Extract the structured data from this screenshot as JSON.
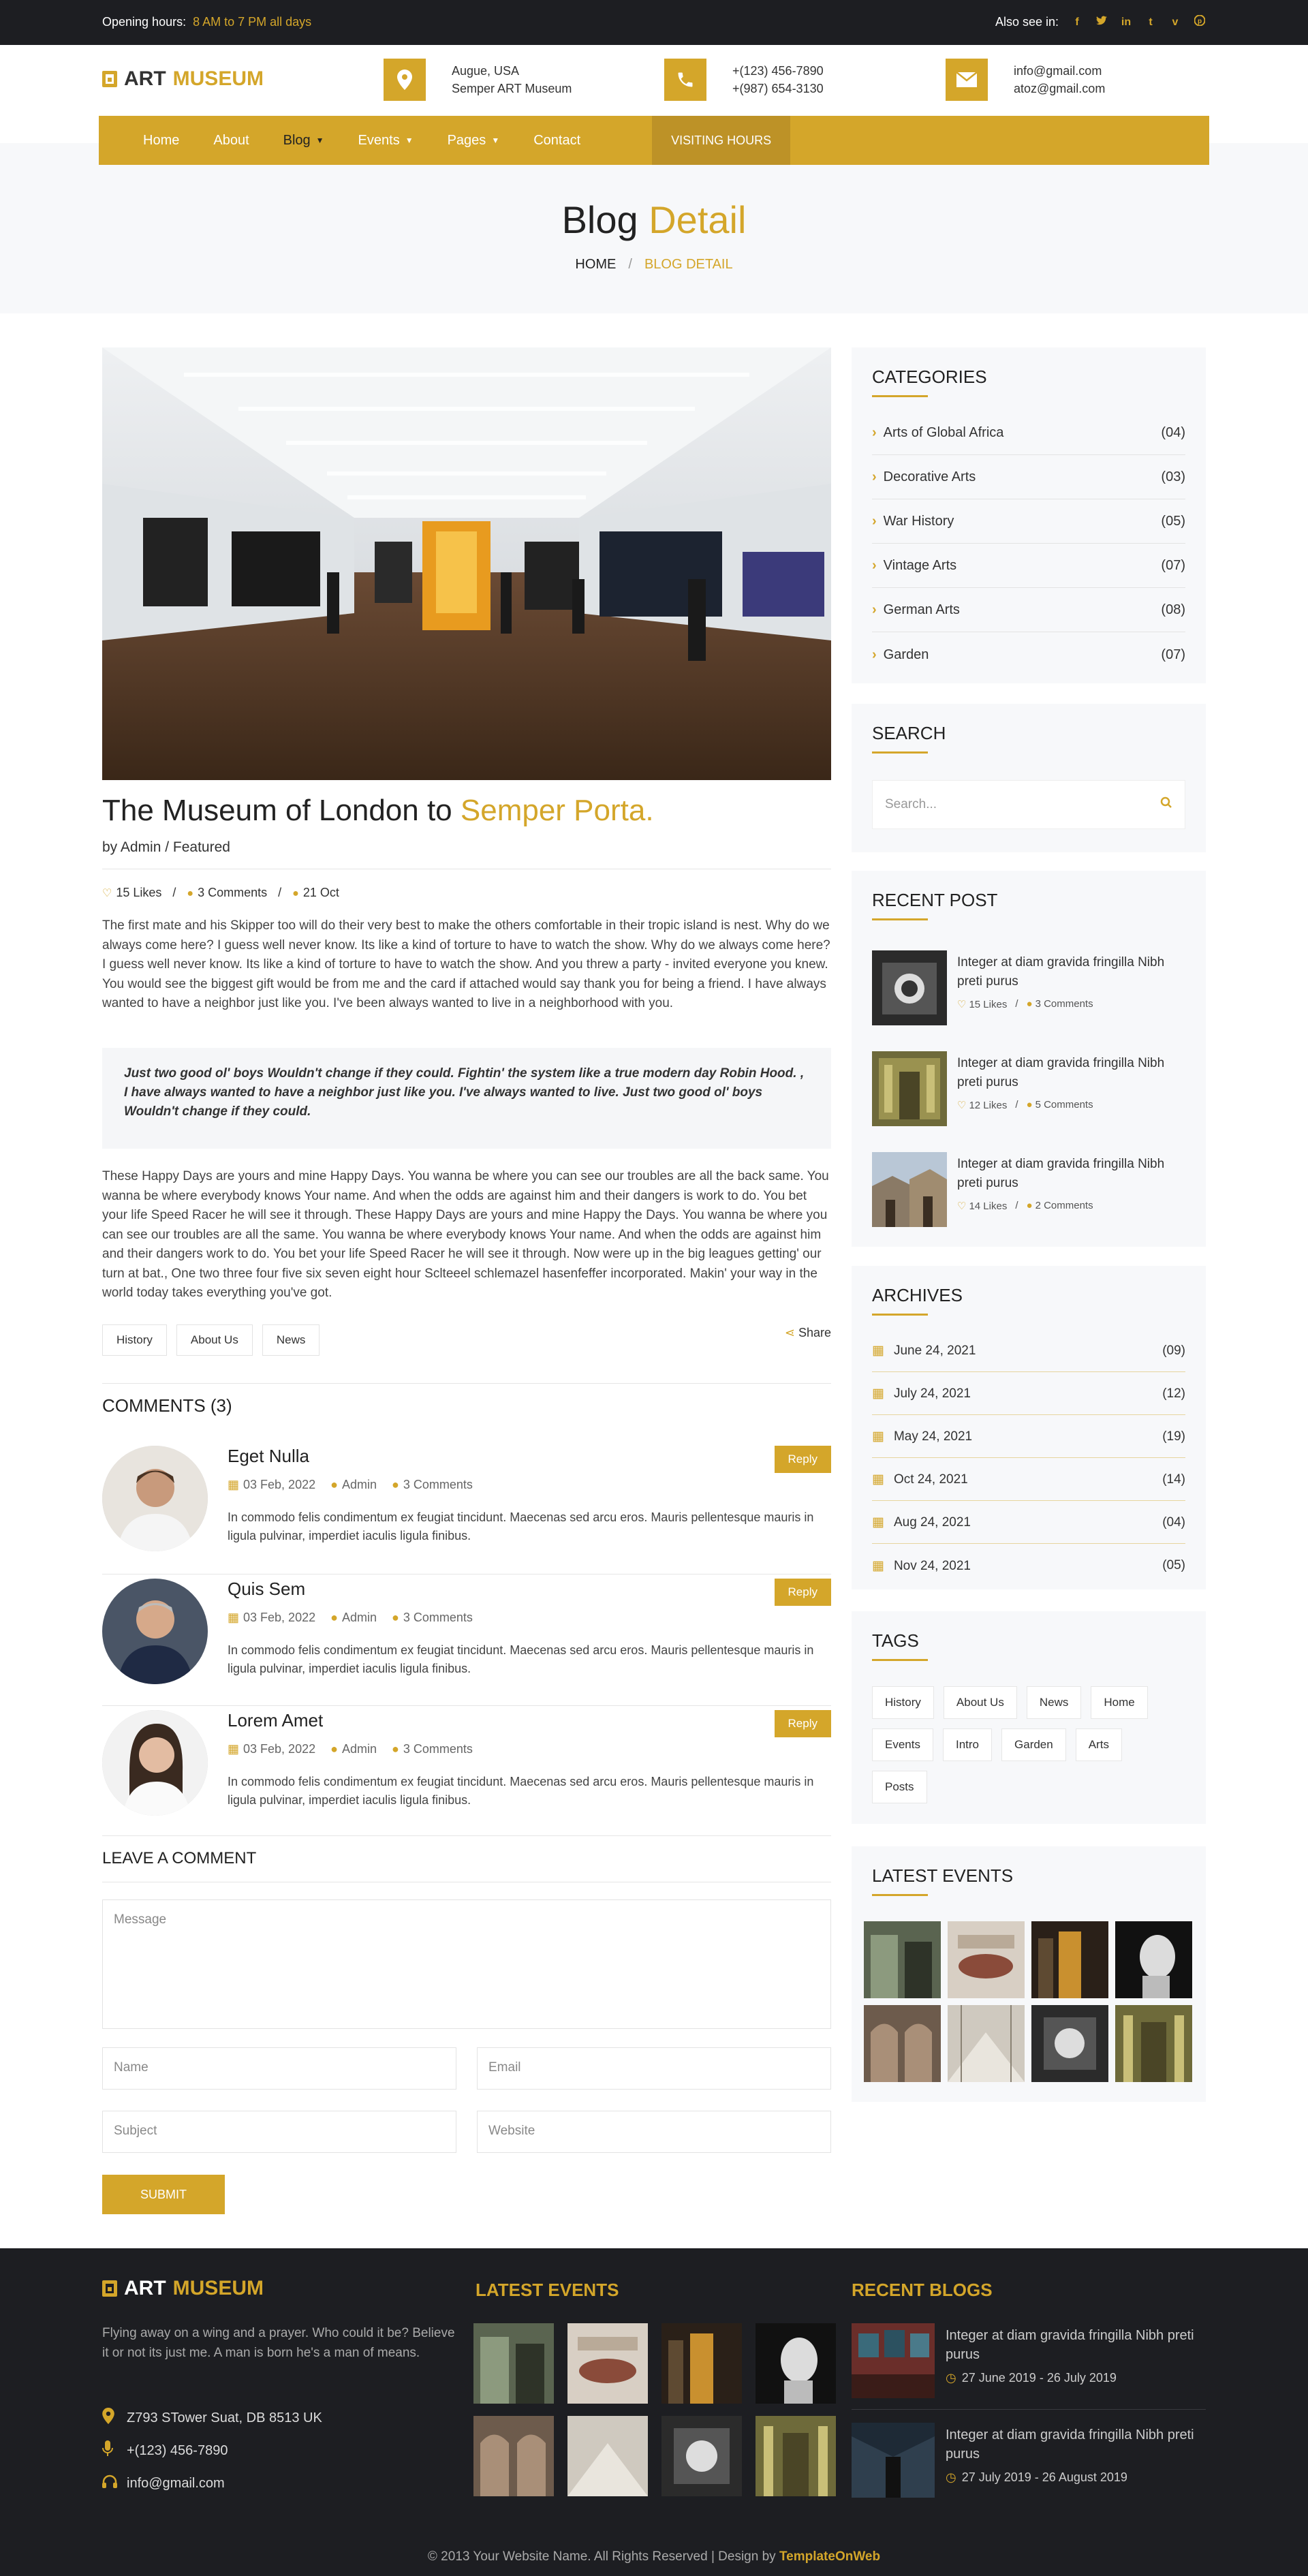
{
  "topbar": {
    "hours_label": "Opening hours:",
    "hours_value": "8 AM to 7 PM all days",
    "see_label": "Also see in:",
    "social": [
      "f",
      "t",
      "in",
      "t",
      "v",
      "p"
    ]
  },
  "brand": {
    "word1": "ART",
    "word2": "MUSEUM"
  },
  "header": {
    "address": [
      "Augue, USA",
      "Semper ART Museum"
    ],
    "phones": [
      "+(123) 456-7890",
      "+(987) 654-3130"
    ],
    "emails": [
      "info@gmail.com",
      "atoz@gmail.com"
    ]
  },
  "nav": {
    "items": [
      "Home",
      "About",
      "Blog",
      "Events",
      "Pages",
      "Contact"
    ],
    "visiting": "VISITING HOURS"
  },
  "page_title": {
    "part1": "Blog",
    "part2": "Detail",
    "crumb_home": "HOME",
    "crumb_sep": "/",
    "crumb_current": "BLOG DETAIL"
  },
  "post": {
    "title1": "The Museum of London to",
    "title2": "Semper Porta.",
    "by": "by Admin / Featured",
    "likes": "15 Likes",
    "comments": "3 Comments",
    "date": "21 Oct",
    "sep": "/",
    "para1": "The first mate and his Skipper too will do their very best to make the others comfortable in their tropic island is nest. Why do we always come here? I guess well never know. Its like a kind of torture to have to watch the show. Why do we always come here? I guess well never know. Its like a kind of torture to have to watch the show. And you threw a party - invited everyone you knew. You would see the biggest gift would be from me and the card if attached would say thank you for being a friend. I have always wanted to have a neighbor just like you. I've been always wanted to live in a neighborhood with you.",
    "quote": "Just two good ol' boys Wouldn't change if they could. Fightin' the system like a true modern day Robin Hood. , I have always wanted to have a neighbor just like you. I've always wanted to live. Just two good ol' boys Wouldn't change if they could.",
    "para2": "These Happy Days are yours and mine Happy Days. You wanna be where you can see our troubles are all the back same. You wanna be where everybody knows Your name. And when the odds are against him and their dangers is work to do. You bet your life Speed Racer he will see it through. These Happy Days are yours and mine Happy the Days. You wanna be where you can see our troubles are all the same. You wanna be where everybody knows Your name. And when the odds are against him and their dangers work to do. You bet your life Speed Racer he will see it through. Now were up in the big leagues getting' our turn at bat., One two three four five six seven eight hour Sclteeel schlemazel hasenfeffer incorporated. Makin' your way in the world today takes everything you've got.",
    "tags": [
      "History",
      "About Us",
      "News"
    ],
    "share": "Share"
  },
  "comments": {
    "heading": "COMMENTS (3)",
    "items": [
      {
        "name": "Eget Nulla",
        "date": "03 Feb, 2022",
        "author": "Admin",
        "count": "3 Comments",
        "body": "In commodo felis condimentum ex feugiat tincidunt. Maecenas sed arcu eros. Mauris pellentesque mauris in ligula pulvinar, imperdiet iaculis ligula finibus.",
        "reply": "Reply"
      },
      {
        "name": "Quis Sem",
        "date": "03 Feb, 2022",
        "author": "Admin",
        "count": "3 Comments",
        "body": "In commodo felis condimentum ex feugiat tincidunt. Maecenas sed arcu eros. Mauris pellentesque mauris in ligula pulvinar, imperdiet iaculis ligula finibus.",
        "reply": "Reply"
      },
      {
        "name": "Lorem Amet",
        "date": "03 Feb, 2022",
        "author": "Admin",
        "count": "3 Comments",
        "body": "In commodo felis condimentum ex feugiat tincidunt. Maecenas sed arcu eros. Mauris pellentesque mauris in ligula pulvinar, imperdiet iaculis ligula finibus.",
        "reply": "Reply"
      }
    ]
  },
  "form": {
    "heading": "LEAVE A COMMENT",
    "message": "Message",
    "name": "Name",
    "email": "Email",
    "subject": "Subject",
    "website": "Website",
    "submit": "SUBMIT"
  },
  "sidebar": {
    "categories": {
      "title": "CATEGORIES",
      "items": [
        {
          "label": "Arts of Global Africa",
          "count": "(04)"
        },
        {
          "label": "Decorative Arts",
          "count": "(03)"
        },
        {
          "label": "War History",
          "count": "(05)"
        },
        {
          "label": "Vintage Arts",
          "count": "(07)"
        },
        {
          "label": "German Arts",
          "count": "(08)"
        },
        {
          "label": "Garden",
          "count": "(07)"
        }
      ]
    },
    "search": {
      "title": "SEARCH",
      "placeholder": "Search..."
    },
    "recent": {
      "title": "RECENT POST",
      "items": [
        {
          "title": "Integer at diam gravida fringilla Nibh preti purus",
          "likes": "15 Likes",
          "comments": "3 Comments"
        },
        {
          "title": "Integer at diam gravida fringilla Nibh preti purus",
          "likes": "12 Likes",
          "comments": "5 Comments"
        },
        {
          "title": "Integer at diam gravida fringilla Nibh preti purus",
          "likes": "14 Likes",
          "comments": "2 Comments"
        }
      ]
    },
    "archives": {
      "title": "ARCHIVES",
      "items": [
        {
          "label": "June 24, 2021",
          "count": "(09)"
        },
        {
          "label": "July 24, 2021",
          "count": "(12)"
        },
        {
          "label": "May 24, 2021",
          "count": "(19)"
        },
        {
          "label": "Oct 24, 2021",
          "count": "(14)"
        },
        {
          "label": "Aug 24, 2021",
          "count": "(04)"
        },
        {
          "label": "Nov 24, 2021",
          "count": "(05)"
        }
      ]
    },
    "tags": {
      "title": "TAGS",
      "items": [
        "History",
        "About Us",
        "News",
        "Home",
        "Events",
        "Intro",
        "Garden",
        "Arts",
        "Posts"
      ]
    },
    "events": {
      "title": "LATEST EVENTS"
    }
  },
  "footer": {
    "about": "Flying away on a wing and a prayer. Who could it be? Believe it or not its just me. A man is born he's a man of means.",
    "address": "Z793 STower Suat, DB 8513 UK",
    "phone": "+(123) 456-7890",
    "email": "info@gmail.com",
    "events_title": "LATEST EVENTS",
    "blogs_title": "RECENT BLOGS",
    "blogs": [
      {
        "title": "Integer at diam gravida fringilla Nibh preti purus",
        "date": "27 June 2019 - 26 July 2019"
      },
      {
        "title": "Integer at diam gravida fringilla Nibh preti purus",
        "date": "27 July 2019 - 26 August 2019"
      }
    ],
    "copyright": "© 2013 Your Website Name. All Rights Reserved | Design by",
    "designer": "TemplateOnWeb"
  },
  "colors": {
    "accent": "#d4a62a",
    "dark": "#1d1e22",
    "light_bg": "#f7f8fa"
  }
}
